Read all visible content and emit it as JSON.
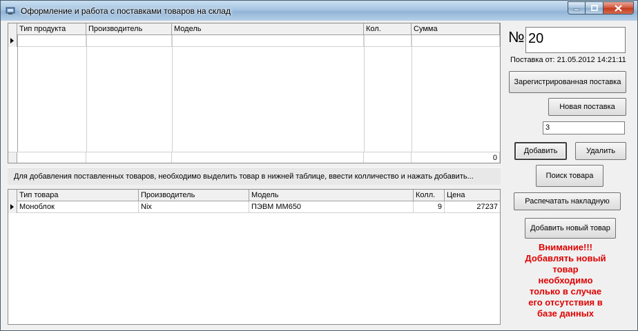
{
  "window": {
    "title": "Оформление и работа с поставками товаров на склад"
  },
  "upper_grid": {
    "columns": [
      "Тип продукта",
      "Производитель",
      "Модель",
      "Кол.",
      "Сумма"
    ],
    "total": "0"
  },
  "hint": "Для добавления поставленных товаров, необходимо выделить товар в нижней таблице, ввести колличество и нажать добавить...",
  "lower_grid": {
    "columns": [
      "Тип товара",
      "Производитель",
      "Модель",
      "Колл.",
      "Цена"
    ],
    "rows": [
      [
        "Моноблок",
        "Nix",
        "ПЭВМ ММ650",
        "9",
        "27237"
      ]
    ]
  },
  "panel": {
    "number_sign": "№",
    "number": "20",
    "date_text": "Поставка от: 21.05.2012 14:21:11",
    "registered_button": "Зарегистрированная поставка",
    "new_button": "Новая поставка",
    "qty_value": "3",
    "add_button": "Добавить",
    "delete_button": "Удалить",
    "search_button": "Поиск товара",
    "print_button": "Распечатать накладную",
    "add_new_product_button": "Добавить новый товар",
    "warning_lines": [
      "Внимание!!!",
      "Добавлять новый",
      "товар",
      "необходимо",
      "только в случае",
      "его отсутствия в",
      "базе данных"
    ]
  },
  "colors": {
    "warning": "#e00000",
    "titlebar": "#a6c4e0"
  }
}
